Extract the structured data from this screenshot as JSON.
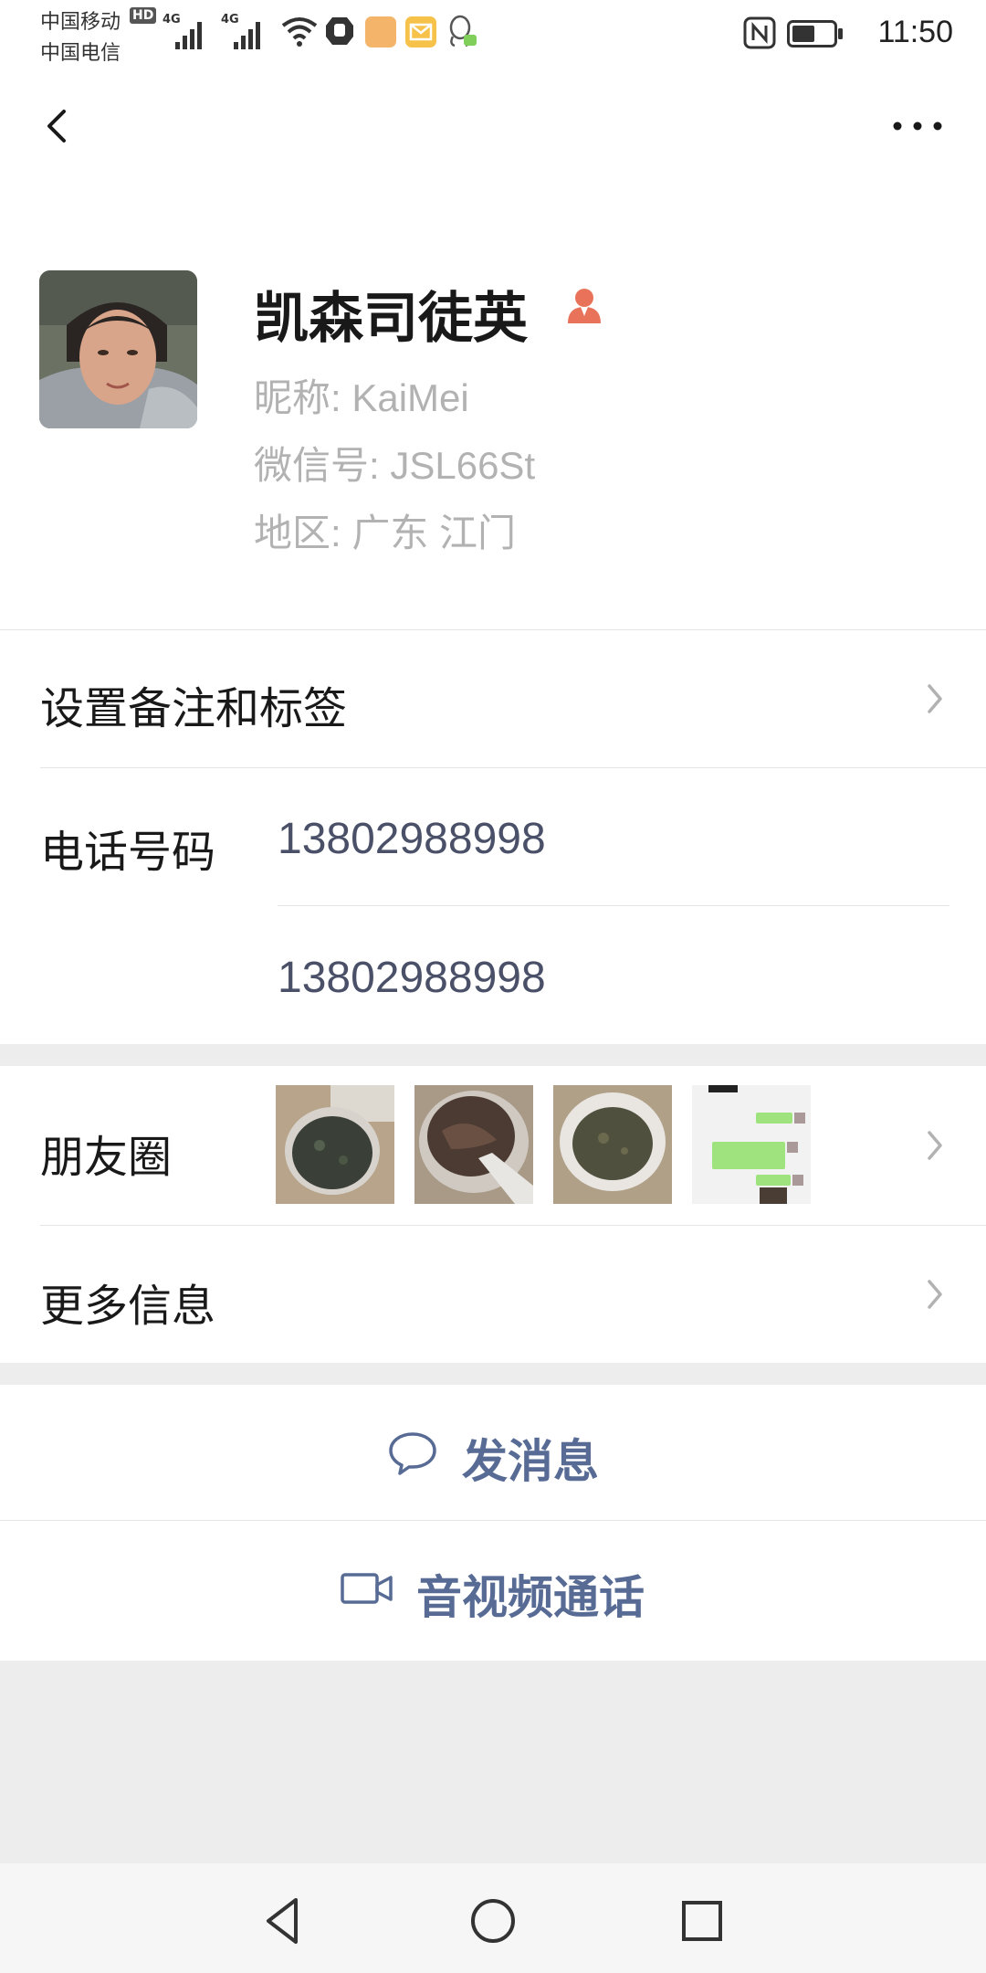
{
  "status_bar": {
    "carrier_top": "中国移动",
    "carrier_bottom": "中国电信",
    "hd_badge": "HD",
    "net1": "4G",
    "net2": "4G",
    "time": "11:50",
    "battery_percent": 55
  },
  "nav": {
    "back_icon": "chevron-left",
    "more_icon": "ellipsis"
  },
  "profile": {
    "name": "凯森司徒英",
    "nickname": "昵称:  KaiMei",
    "wechat_id": "微信号:  JSL66St",
    "region": "地区:  广东  江门"
  },
  "rows": {
    "remark_label": "设置备注和标签",
    "phone_label": "电话号码",
    "phone_numbers": [
      "13802988998",
      "13802988998"
    ],
    "moments_label": "朋友圈",
    "more_info_label": "更多信息"
  },
  "actions": {
    "message_label": "发消息",
    "call_label": "音视频通话"
  },
  "colors": {
    "link_blue": "#576b95",
    "separator": "#e5e5e5",
    "gray_bg": "#ededed",
    "text": "#191919",
    "sub_text": "#b2b2b2"
  }
}
